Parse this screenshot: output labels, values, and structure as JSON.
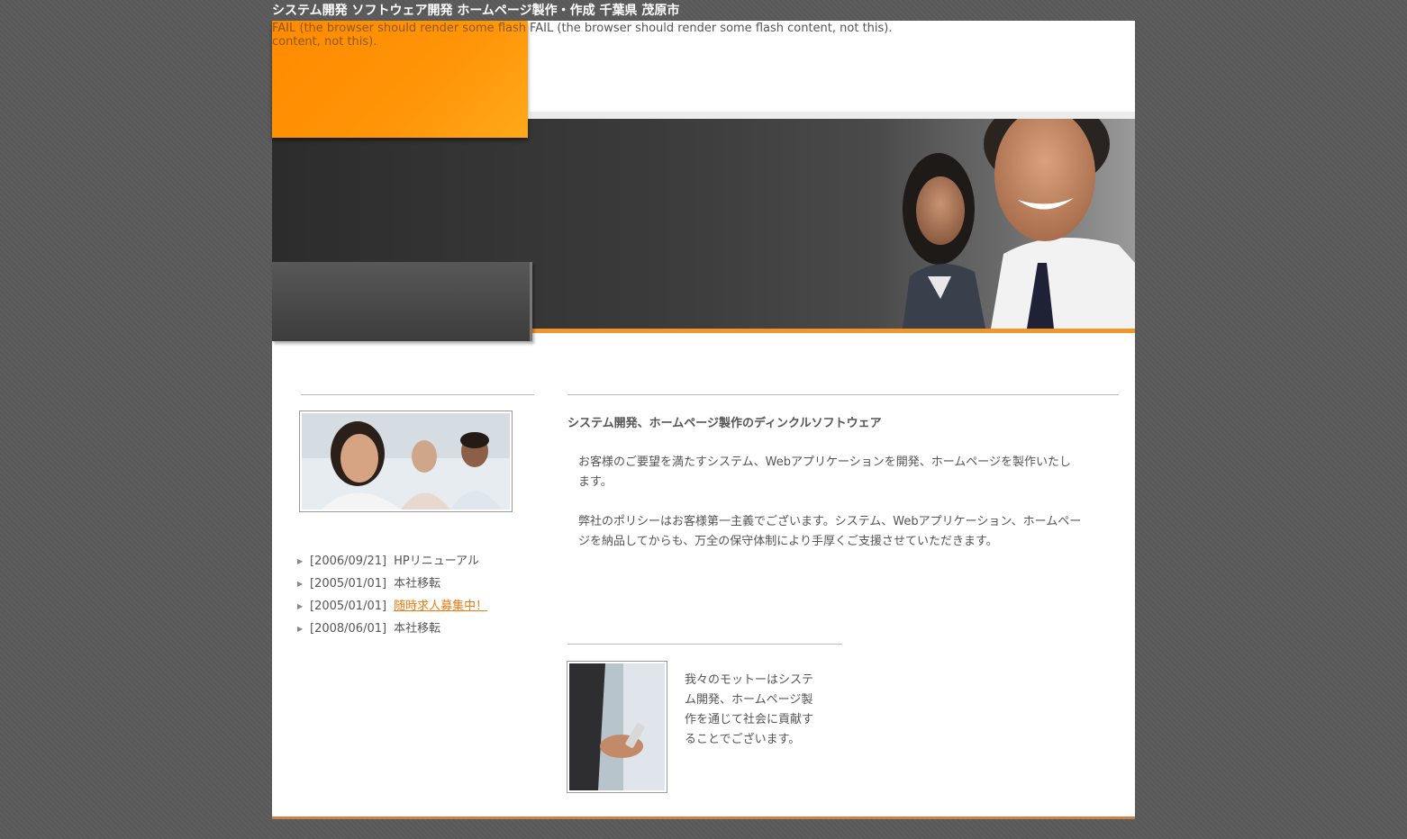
{
  "site": {
    "title": "システム開発 ソフトウェア開発 ホームページ製作・作成 千葉県 茂原市"
  },
  "header": {
    "flash_fail_left": "FAIL (the browser should render some flash content, not this).",
    "flash_fail_right": "FAIL (the browser should render some flash content, not this)."
  },
  "news": [
    {
      "date": "[2006/09/21]",
      "text": "HPリニューアル",
      "link": false
    },
    {
      "date": "[2005/01/01]",
      "text": "本社移転",
      "link": false
    },
    {
      "date": "[2005/01/01]",
      "text": "随時求人募集中！",
      "link": true
    },
    {
      "date": "[2008/06/01]",
      "text": "本社移転",
      "link": false
    }
  ],
  "main": {
    "heading": "システム開発、ホームページ製作のディンクルソフトウェア",
    "paragraph1": "お客様のご要望を満たすシステム、Webアプリケーションを開発、ホームページを製作いたします。",
    "paragraph2": "弊社のポリシーはお客様第一主義でございます。システム、Webアプリケーション、ホームページを納品してからも、万全の保守体制により手厚くご支援させていただきます。",
    "motto": "我々のモットーはシステム開発、ホームページ製作を通じて社会に貢献することでございます。"
  },
  "colors": {
    "accent_orange": "#ff8a00",
    "link_orange": "#f07b10",
    "background": "#5a5a5a"
  }
}
